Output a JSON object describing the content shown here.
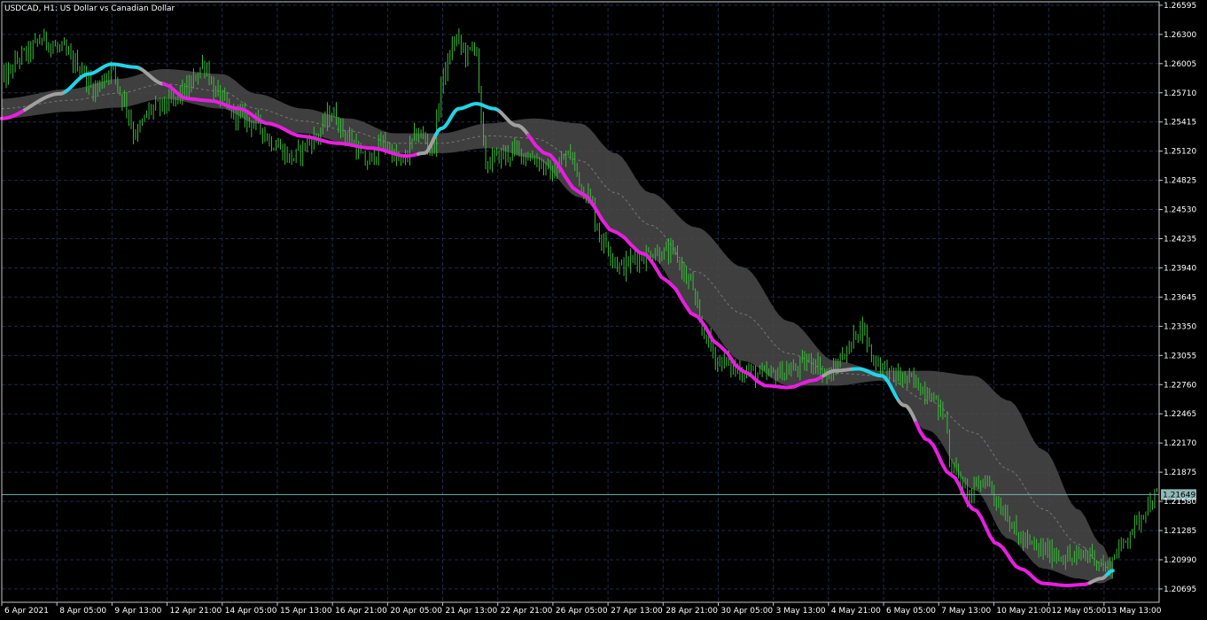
{
  "window": {
    "symbol_line": "USDCAD, H1:  US Dollar vs Canadian Dollar"
  },
  "colors": {
    "background": "#000000",
    "grid": "#1e2a4a",
    "axis": "#c8c8c8",
    "candles": "#3aba3a",
    "band_fill": "#4a4a4a",
    "band_mid": "#777777",
    "trend_up": "#22d4e8",
    "trend_down": "#e81ee0",
    "trend_flat": "#a0a0a0",
    "current_price_line": "#7fb0b0",
    "price_tag_bg": "#8fb8b8"
  },
  "chart_data": {
    "type": "line",
    "title": "USDCAD, H1:  US Dollar vs Canadian Dollar",
    "current_price": 1.21649,
    "current_price_label": "1.21649",
    "ylim": [
      1.2056,
      1.2663
    ],
    "y_ticks": [
      "1.26595",
      "1.26300",
      "1.26005",
      "1.25710",
      "1.25415",
      "1.25120",
      "1.24825",
      "1.24530",
      "1.24235",
      "1.23940",
      "1.23645",
      "1.23350",
      "1.23055",
      "1.22760",
      "1.22465",
      "1.22170",
      "1.21875",
      "1.21580",
      "1.21285",
      "1.20990",
      "1.20695"
    ],
    "x_ticks": [
      "6 Apr 2021",
      "8 Apr 05:00",
      "9 Apr 13:00",
      "12 Apr 21:00",
      "14 Apr 05:00",
      "15 Apr 13:00",
      "16 Apr 21:00",
      "20 Apr 05:00",
      "21 Apr 13:00",
      "22 Apr 21:00",
      "26 Apr 05:00",
      "27 Apr 13:00",
      "28 Apr 21:00",
      "30 Apr 05:00",
      "3 May 13:00",
      "4 May 21:00",
      "6 May 05:00",
      "7 May 13:00",
      "10 May 21:00",
      "12 May 05:00",
      "13 May 13:00"
    ],
    "price_keyframes": [
      [
        0,
        1.2585
      ],
      [
        0.02,
        1.261
      ],
      [
        0.035,
        1.2625
      ],
      [
        0.05,
        1.2615
      ],
      [
        0.065,
        1.26
      ],
      [
        0.08,
        1.2575
      ],
      [
        0.095,
        1.2595
      ],
      [
        0.105,
        1.2565
      ],
      [
        0.115,
        1.253
      ],
      [
        0.13,
        1.2555
      ],
      [
        0.145,
        1.256
      ],
      [
        0.16,
        1.2575
      ],
      [
        0.175,
        1.26
      ],
      [
        0.185,
        1.257
      ],
      [
        0.2,
        1.255
      ],
      [
        0.22,
        1.254
      ],
      [
        0.235,
        1.252
      ],
      [
        0.25,
        1.2505
      ],
      [
        0.27,
        1.2525
      ],
      [
        0.285,
        1.255
      ],
      [
        0.3,
        1.2525
      ],
      [
        0.315,
        1.25
      ],
      [
        0.33,
        1.252
      ],
      [
        0.345,
        1.25
      ],
      [
        0.36,
        1.253
      ],
      [
        0.372,
        1.2515
      ],
      [
        0.382,
        1.259
      ],
      [
        0.392,
        1.2625
      ],
      [
        0.402,
        1.261
      ],
      [
        0.41,
        1.262
      ],
      [
        0.414,
        1.254
      ],
      [
        0.418,
        1.25
      ],
      [
        0.432,
        1.2508
      ],
      [
        0.445,
        1.2512
      ],
      [
        0.46,
        1.2505
      ],
      [
        0.475,
        1.249
      ],
      [
        0.49,
        1.2508
      ],
      [
        0.505,
        1.247
      ],
      [
        0.52,
        1.242
      ],
      [
        0.535,
        1.2395
      ],
      [
        0.55,
        1.2405
      ],
      [
        0.565,
        1.241
      ],
      [
        0.58,
        1.2408
      ],
      [
        0.595,
        1.238
      ],
      [
        0.605,
        1.233
      ],
      [
        0.62,
        1.23
      ],
      [
        0.64,
        1.229
      ],
      [
        0.66,
        1.2285
      ],
      [
        0.68,
        1.229
      ],
      [
        0.7,
        1.23
      ],
      [
        0.715,
        1.2285
      ],
      [
        0.73,
        1.231
      ],
      [
        0.742,
        1.2335
      ],
      [
        0.755,
        1.23
      ],
      [
        0.77,
        1.2285
      ],
      [
        0.785,
        1.228
      ],
      [
        0.8,
        1.227
      ],
      [
        0.815,
        1.2245
      ],
      [
        0.82,
        1.2195
      ],
      [
        0.835,
        1.2165
      ],
      [
        0.85,
        1.218
      ],
      [
        0.865,
        1.215
      ],
      [
        0.88,
        1.212
      ],
      [
        0.895,
        1.211
      ],
      [
        0.91,
        1.2105
      ],
      [
        0.925,
        1.21
      ],
      [
        0.94,
        1.2105
      ],
      [
        0.955,
        1.209
      ],
      [
        0.965,
        1.211
      ],
      [
        0.98,
        1.2135
      ],
      [
        0.99,
        1.2155
      ],
      [
        1.0,
        1.2165
      ]
    ],
    "trend_keyframes": [
      [
        0,
        1.2545
      ],
      [
        0.05,
        1.257
      ],
      [
        0.075,
        1.259
      ],
      [
        0.095,
        1.26
      ],
      [
        0.115,
        1.2597
      ],
      [
        0.14,
        1.258
      ],
      [
        0.16,
        1.2565
      ],
      [
        0.18,
        1.2563
      ],
      [
        0.205,
        1.2555
      ],
      [
        0.23,
        1.254
      ],
      [
        0.26,
        1.2527
      ],
      [
        0.29,
        1.252
      ],
      [
        0.32,
        1.2515
      ],
      [
        0.35,
        1.2507
      ],
      [
        0.365,
        1.251
      ],
      [
        0.38,
        1.2535
      ],
      [
        0.395,
        1.2555
      ],
      [
        0.41,
        1.256
      ],
      [
        0.425,
        1.2555
      ],
      [
        0.445,
        1.2538
      ],
      [
        0.47,
        1.251
      ],
      [
        0.5,
        1.247
      ],
      [
        0.53,
        1.243
      ],
      [
        0.555,
        1.2408
      ],
      [
        0.575,
        1.238
      ],
      [
        0.6,
        1.2345
      ],
      [
        0.62,
        1.2315
      ],
      [
        0.64,
        1.229
      ],
      [
        0.66,
        1.2275
      ],
      [
        0.68,
        1.2273
      ],
      [
        0.7,
        1.228
      ],
      [
        0.72,
        1.229
      ],
      [
        0.74,
        1.2292
      ],
      [
        0.76,
        1.2285
      ],
      [
        0.78,
        1.2255
      ],
      [
        0.8,
        1.222
      ],
      [
        0.82,
        1.2185
      ],
      [
        0.84,
        1.215
      ],
      [
        0.86,
        1.2115
      ],
      [
        0.88,
        1.209
      ],
      [
        0.9,
        1.2075
      ],
      [
        0.92,
        1.2073
      ],
      [
        0.935,
        1.2074
      ],
      [
        0.95,
        1.208
      ],
      [
        0.96,
        1.2088
      ]
    ],
    "trend_direction_breaks": [
      [
        0,
        "down"
      ],
      [
        0.02,
        "flat"
      ],
      [
        0.055,
        "up"
      ],
      [
        0.12,
        "flat"
      ],
      [
        0.14,
        "down"
      ],
      [
        0.36,
        "flat"
      ],
      [
        0.375,
        "up"
      ],
      [
        0.43,
        "flat"
      ],
      [
        0.455,
        "down"
      ],
      [
        0.71,
        "flat"
      ],
      [
        0.735,
        "up"
      ],
      [
        0.775,
        "flat"
      ],
      [
        0.79,
        "down"
      ],
      [
        0.94,
        "flat"
      ],
      [
        0.955,
        "up"
      ]
    ],
    "band_upper_keyframes": [
      [
        0,
        1.2565
      ],
      [
        0.06,
        1.2575
      ],
      [
        0.1,
        1.2585
      ],
      [
        0.14,
        1.2595
      ],
      [
        0.19,
        1.259
      ],
      [
        0.22,
        1.257
      ],
      [
        0.26,
        1.2555
      ],
      [
        0.3,
        1.2545
      ],
      [
        0.34,
        1.253
      ],
      [
        0.38,
        1.253
      ],
      [
        0.42,
        1.254
      ],
      [
        0.46,
        1.2545
      ],
      [
        0.5,
        1.254
      ],
      [
        0.53,
        1.251
      ],
      [
        0.56,
        1.247
      ],
      [
        0.6,
        1.2435
      ],
      [
        0.64,
        1.2395
      ],
      [
        0.68,
        1.234
      ],
      [
        0.72,
        1.23
      ],
      [
        0.76,
        1.229
      ],
      [
        0.8,
        1.229
      ],
      [
        0.84,
        1.2285
      ],
      [
        0.87,
        1.226
      ],
      [
        0.9,
        1.221
      ],
      [
        0.93,
        1.215
      ],
      [
        0.95,
        1.2115
      ],
      [
        0.96,
        1.2095
      ]
    ],
    "band_lower_keyframes": [
      [
        0,
        1.2545
      ],
      [
        0.06,
        1.2552
      ],
      [
        0.1,
        1.2556
      ],
      [
        0.14,
        1.2565
      ],
      [
        0.19,
        1.2555
      ],
      [
        0.22,
        1.254
      ],
      [
        0.26,
        1.253
      ],
      [
        0.3,
        1.252
      ],
      [
        0.34,
        1.251
      ],
      [
        0.38,
        1.251
      ],
      [
        0.42,
        1.2515
      ],
      [
        0.46,
        1.2505
      ],
      [
        0.5,
        1.2465
      ],
      [
        0.53,
        1.243
      ],
      [
        0.56,
        1.2405
      ],
      [
        0.6,
        1.2345
      ],
      [
        0.64,
        1.23
      ],
      [
        0.68,
        1.2275
      ],
      [
        0.72,
        1.2275
      ],
      [
        0.76,
        1.228
      ],
      [
        0.8,
        1.223
      ],
      [
        0.84,
        1.217
      ],
      [
        0.87,
        1.212
      ],
      [
        0.9,
        1.209
      ],
      [
        0.93,
        1.208
      ],
      [
        0.95,
        1.2075
      ],
      [
        0.96,
        1.208
      ]
    ]
  }
}
